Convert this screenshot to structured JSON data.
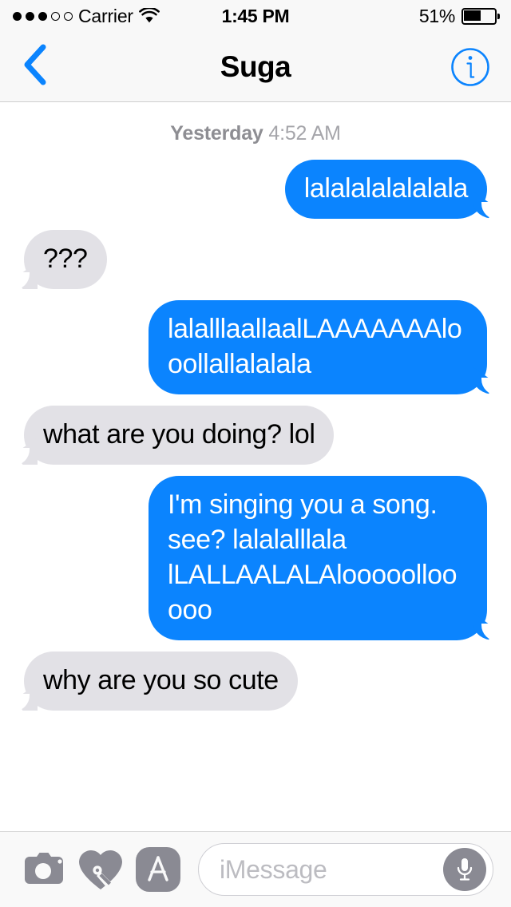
{
  "status_bar": {
    "signal_dots": {
      "filled": 3,
      "empty": 2
    },
    "carrier": "Carrier",
    "wifi_icon": "wifi-icon",
    "time": "1:45 PM",
    "battery_percent": "51%",
    "battery_level": 0.51
  },
  "nav_bar": {
    "back_icon": "chevron-left-icon",
    "title": "Suga",
    "info_icon": "info-circle-icon",
    "info_label": "i"
  },
  "thread": {
    "timestamp": {
      "day": "Yesterday",
      "time": "4:52 AM"
    },
    "messages": [
      {
        "side": "out",
        "text": "lalalalalalalala"
      },
      {
        "side": "in",
        "text": "???"
      },
      {
        "side": "out",
        "text": "lalalllaallaalLAAAAAAAlooollallalalala"
      },
      {
        "side": "in",
        "text": "what are you doing? lol"
      },
      {
        "side": "out",
        "text": "I'm singing you a song. see? lalalalllala lLALLAALALAlooooolloo ooo"
      },
      {
        "side": "in",
        "text": "why are you so cute"
      }
    ]
  },
  "toolbar": {
    "camera_icon": "camera-icon",
    "digital_touch_icon": "heart-digital-touch-icon",
    "app_store_icon": "app-store-icon",
    "input_placeholder": "iMessage",
    "input_value": "",
    "mic_icon": "microphone-icon"
  },
  "colors": {
    "outgoing_bubble": "#0b84fe",
    "incoming_bubble": "#e2e1e6",
    "accent_blue": "#0b84fe",
    "bar_background": "#f8f8f8",
    "timestamp_text": "#a5a5aa",
    "toolbar_icon": "#8a8a93"
  }
}
